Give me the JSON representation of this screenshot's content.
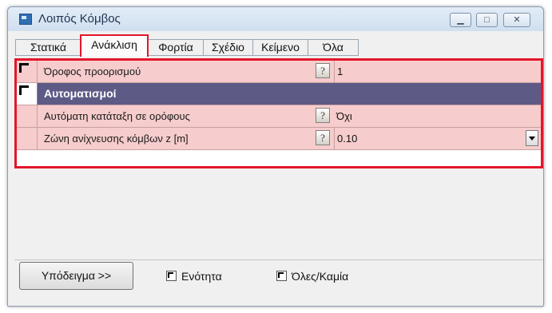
{
  "window": {
    "title": "Λοιπός Κόμβος",
    "accent_color": "#e3152b",
    "group_color": "#5d5a86",
    "row_color": "#f6cccc"
  },
  "titlebar_buttons": {
    "minimize_icon": "minimize-icon",
    "maximize_icon": "maximize-icon",
    "close_icon": "close-icon"
  },
  "tabs": [
    {
      "label": "Στατικά",
      "active": false
    },
    {
      "label": "Ανάκλιση",
      "active": true
    },
    {
      "label": "Φορτία",
      "active": false
    },
    {
      "label": "Σχέδιο",
      "active": false
    },
    {
      "label": "Κείμενο",
      "active": false
    },
    {
      "label": "Όλα",
      "active": false
    }
  ],
  "grid": {
    "rows": [
      {
        "label": "Όροφος προορισμού",
        "help": "?",
        "value": "1",
        "checked": true
      },
      {
        "label": "Αυτοματισμοί",
        "group": true,
        "checked": true
      },
      {
        "label": "Αυτόματη κατάταξη σε ορόφους",
        "help": "?",
        "value": "Όχι"
      },
      {
        "label": "Ζώνη ανίχνευσης κόμβων z [m]",
        "help": "?",
        "value": "0.10",
        "dropdown": true
      }
    ]
  },
  "footer": {
    "template_button": "Υπόδειγμα >>",
    "unit_checkbox": "Ενότητα",
    "all_none_checkbox": "Όλες/Καμία"
  }
}
